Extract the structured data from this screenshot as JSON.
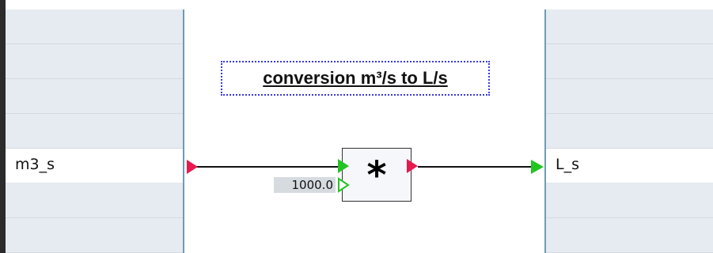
{
  "diagram": {
    "comment": "conversion m³/s to L/s",
    "input_variable": "m3_s",
    "output_variable": "L_s",
    "operator_symbol": "*",
    "constant_value": "1000.0"
  },
  "colors": {
    "panel_row_bg": "#e6ebf1",
    "divider": "#6e9bb5",
    "port_output": "#e8194f",
    "port_input": "#22c422",
    "comment_border": "#3a3adf"
  },
  "icons": [
    "output-port-icon",
    "input-port-icon",
    "constant-input-port-icon"
  ]
}
